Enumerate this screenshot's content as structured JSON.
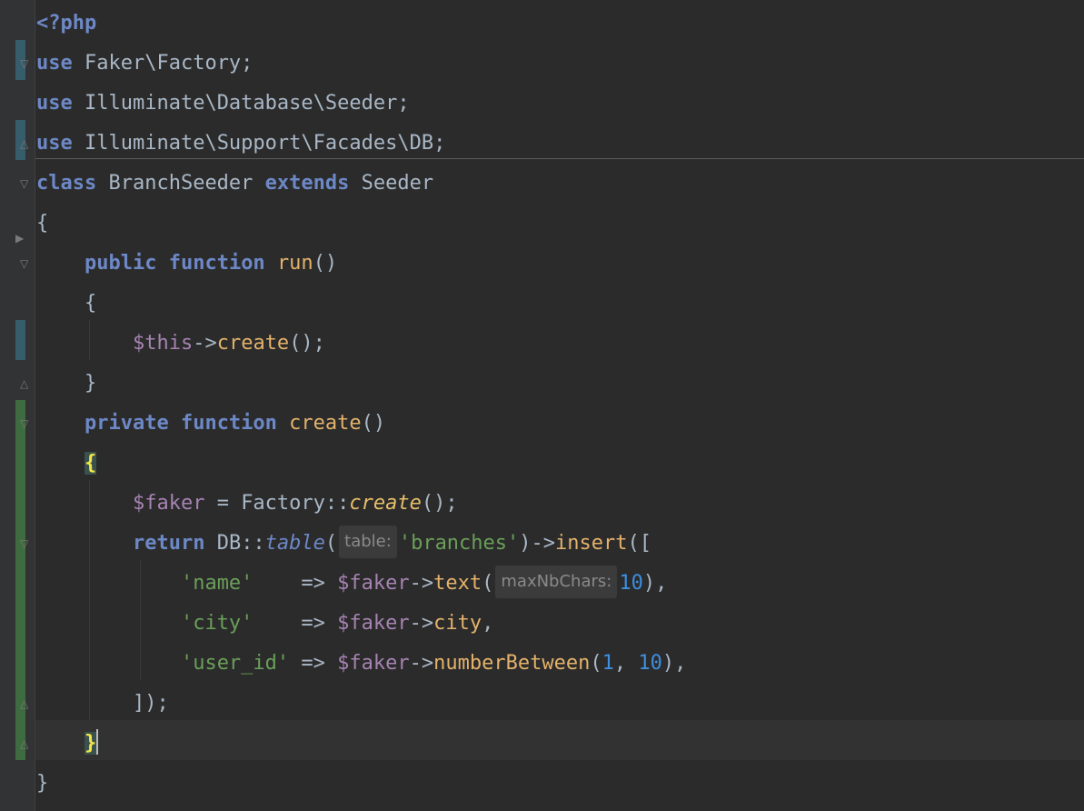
{
  "editor": {
    "language": "php",
    "colors": {
      "background": "#2b2b2b",
      "keyword": "#6d88c6",
      "function": "#e3b26b",
      "variable": "#a683b3",
      "string": "#6a9f59",
      "number": "#3d8fe0",
      "default": "#a9b7c6",
      "matched_brace": "#f1e649",
      "vcs_modified": "#375c6b",
      "vcs_added": "#3e6b3f"
    },
    "lines": {
      "l1": {
        "t1": "<?php"
      },
      "l2": {
        "t1": "use",
        "t2": " Faker\\Factory;"
      },
      "l3": {
        "t1": "use",
        "t2": " Illuminate\\Database\\Seeder;"
      },
      "l4": {
        "t1": "use",
        "t2": " Illuminate\\Support\\Facades\\DB;"
      },
      "l5": {
        "t1": "class",
        "t2": " BranchSeeder ",
        "t3": "extends",
        "t4": " Seeder"
      },
      "l6": {
        "t1": "{"
      },
      "l7": {
        "t1": "    ",
        "t2": "public",
        "t3": " ",
        "t4": "function",
        "t5": " ",
        "t6": "run",
        "t7": "()"
      },
      "l8": {
        "t1": "    {"
      },
      "l9": {
        "t1": "        ",
        "t2": "$this",
        "t3": "->",
        "t4": "create",
        "t5": "();"
      },
      "l10": {
        "t1": "    }"
      },
      "l11": {
        "t1": "    ",
        "t2": "private",
        "t3": " ",
        "t4": "function",
        "t5": " ",
        "t6": "create",
        "t7": "()"
      },
      "l12": {
        "t1": "    ",
        "t2": "{"
      },
      "l13": {
        "t1": "        ",
        "t2": "$faker",
        "t3": " = Factory::",
        "t4": "create",
        "t5": "();"
      },
      "l14": {
        "t1": "        ",
        "t2": "return",
        "t3": " DB::",
        "t4": "table",
        "t5": "(",
        "hint": "table:",
        "t6": "'branches'",
        "t7": ")->",
        "t8": "insert",
        "t9": "(["
      },
      "l15": {
        "t1": "            ",
        "t2": "'name'",
        "t3": "    => ",
        "t4": "$faker",
        "t5": "->",
        "t6": "text",
        "t7": "(",
        "hint": "maxNbChars:",
        "t8": "10",
        "t9": "),"
      },
      "l16": {
        "t1": "            ",
        "t2": "'city'",
        "t3": "    => ",
        "t4": "$faker",
        "t5": "->",
        "t6": "city",
        "t7": ","
      },
      "l17": {
        "t1": "            ",
        "t2": "'user_id'",
        "t3": " => ",
        "t4": "$faker",
        "t5": "->",
        "t6": "numberBetween",
        "t7": "(",
        "t8": "1",
        "t9": ", ",
        "t10": "10",
        "t11": "),"
      },
      "l18": {
        "t1": "        ]);"
      },
      "l19": {
        "t1": "    ",
        "t2": "}"
      },
      "l20": {
        "t1": "}"
      }
    }
  }
}
